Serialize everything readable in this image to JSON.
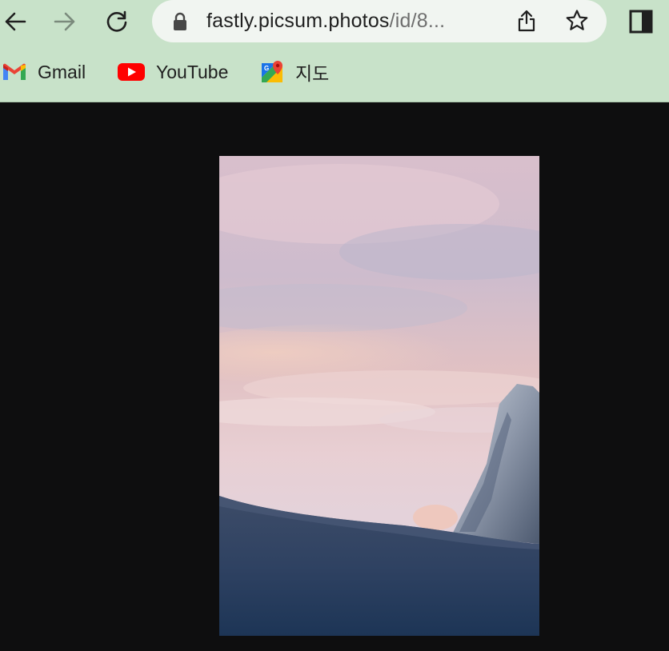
{
  "browser": {
    "url_host": "fastly.picsum.photos",
    "url_path": "/id/8...",
    "colors": {
      "chrome_bg": "#c8e2c9",
      "omnibox_bg": "#f1f5f1",
      "page_bg": "#0e0e0f"
    }
  },
  "toolbar": {
    "back_icon": "arrow-left-icon",
    "forward_icon": "arrow-right-icon",
    "reload_icon": "reload-icon",
    "lock_icon": "lock-icon",
    "share_icon": "share-icon",
    "bookmark_star_icon": "star-icon",
    "side_panel_icon": "side-panel-icon"
  },
  "bookmarks": [
    {
      "label": "Gmail",
      "icon": "gmail-icon"
    },
    {
      "label": "YouTube",
      "icon": "youtube-icon"
    },
    {
      "label": "지도",
      "icon": "google-maps-icon"
    }
  ],
  "content": {
    "image_subject": "snowy mountain peak under pink sunset sky"
  }
}
